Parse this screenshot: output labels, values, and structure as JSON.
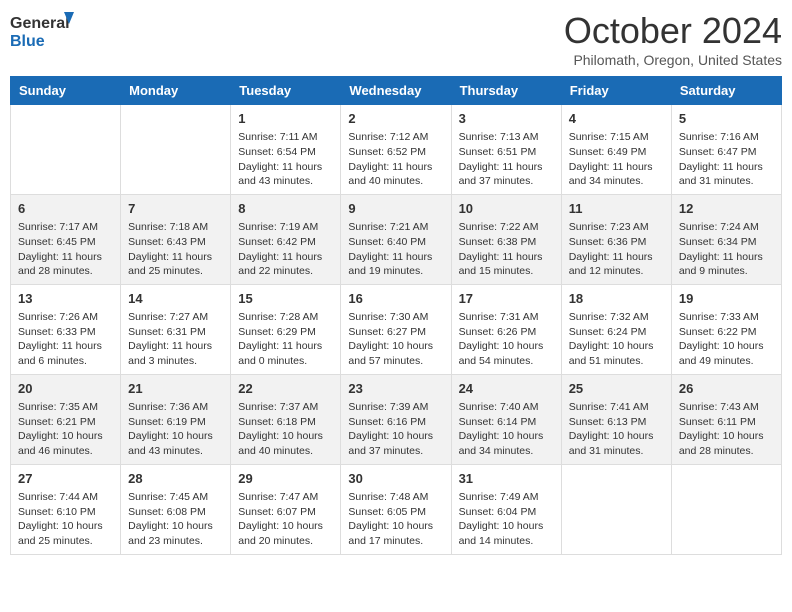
{
  "header": {
    "logo_line1": "General",
    "logo_line2": "Blue",
    "month": "October 2024",
    "location": "Philomath, Oregon, United States"
  },
  "days_of_week": [
    "Sunday",
    "Monday",
    "Tuesday",
    "Wednesday",
    "Thursday",
    "Friday",
    "Saturday"
  ],
  "weeks": [
    [
      {
        "day": "",
        "sunrise": "",
        "sunset": "",
        "daylight": ""
      },
      {
        "day": "",
        "sunrise": "",
        "sunset": "",
        "daylight": ""
      },
      {
        "day": "1",
        "sunrise": "Sunrise: 7:11 AM",
        "sunset": "Sunset: 6:54 PM",
        "daylight": "Daylight: 11 hours and 43 minutes."
      },
      {
        "day": "2",
        "sunrise": "Sunrise: 7:12 AM",
        "sunset": "Sunset: 6:52 PM",
        "daylight": "Daylight: 11 hours and 40 minutes."
      },
      {
        "day": "3",
        "sunrise": "Sunrise: 7:13 AM",
        "sunset": "Sunset: 6:51 PM",
        "daylight": "Daylight: 11 hours and 37 minutes."
      },
      {
        "day": "4",
        "sunrise": "Sunrise: 7:15 AM",
        "sunset": "Sunset: 6:49 PM",
        "daylight": "Daylight: 11 hours and 34 minutes."
      },
      {
        "day": "5",
        "sunrise": "Sunrise: 7:16 AM",
        "sunset": "Sunset: 6:47 PM",
        "daylight": "Daylight: 11 hours and 31 minutes."
      }
    ],
    [
      {
        "day": "6",
        "sunrise": "Sunrise: 7:17 AM",
        "sunset": "Sunset: 6:45 PM",
        "daylight": "Daylight: 11 hours and 28 minutes."
      },
      {
        "day": "7",
        "sunrise": "Sunrise: 7:18 AM",
        "sunset": "Sunset: 6:43 PM",
        "daylight": "Daylight: 11 hours and 25 minutes."
      },
      {
        "day": "8",
        "sunrise": "Sunrise: 7:19 AM",
        "sunset": "Sunset: 6:42 PM",
        "daylight": "Daylight: 11 hours and 22 minutes."
      },
      {
        "day": "9",
        "sunrise": "Sunrise: 7:21 AM",
        "sunset": "Sunset: 6:40 PM",
        "daylight": "Daylight: 11 hours and 19 minutes."
      },
      {
        "day": "10",
        "sunrise": "Sunrise: 7:22 AM",
        "sunset": "Sunset: 6:38 PM",
        "daylight": "Daylight: 11 hours and 15 minutes."
      },
      {
        "day": "11",
        "sunrise": "Sunrise: 7:23 AM",
        "sunset": "Sunset: 6:36 PM",
        "daylight": "Daylight: 11 hours and 12 minutes."
      },
      {
        "day": "12",
        "sunrise": "Sunrise: 7:24 AM",
        "sunset": "Sunset: 6:34 PM",
        "daylight": "Daylight: 11 hours and 9 minutes."
      }
    ],
    [
      {
        "day": "13",
        "sunrise": "Sunrise: 7:26 AM",
        "sunset": "Sunset: 6:33 PM",
        "daylight": "Daylight: 11 hours and 6 minutes."
      },
      {
        "day": "14",
        "sunrise": "Sunrise: 7:27 AM",
        "sunset": "Sunset: 6:31 PM",
        "daylight": "Daylight: 11 hours and 3 minutes."
      },
      {
        "day": "15",
        "sunrise": "Sunrise: 7:28 AM",
        "sunset": "Sunset: 6:29 PM",
        "daylight": "Daylight: 11 hours and 0 minutes."
      },
      {
        "day": "16",
        "sunrise": "Sunrise: 7:30 AM",
        "sunset": "Sunset: 6:27 PM",
        "daylight": "Daylight: 10 hours and 57 minutes."
      },
      {
        "day": "17",
        "sunrise": "Sunrise: 7:31 AM",
        "sunset": "Sunset: 6:26 PM",
        "daylight": "Daylight: 10 hours and 54 minutes."
      },
      {
        "day": "18",
        "sunrise": "Sunrise: 7:32 AM",
        "sunset": "Sunset: 6:24 PM",
        "daylight": "Daylight: 10 hours and 51 minutes."
      },
      {
        "day": "19",
        "sunrise": "Sunrise: 7:33 AM",
        "sunset": "Sunset: 6:22 PM",
        "daylight": "Daylight: 10 hours and 49 minutes."
      }
    ],
    [
      {
        "day": "20",
        "sunrise": "Sunrise: 7:35 AM",
        "sunset": "Sunset: 6:21 PM",
        "daylight": "Daylight: 10 hours and 46 minutes."
      },
      {
        "day": "21",
        "sunrise": "Sunrise: 7:36 AM",
        "sunset": "Sunset: 6:19 PM",
        "daylight": "Daylight: 10 hours and 43 minutes."
      },
      {
        "day": "22",
        "sunrise": "Sunrise: 7:37 AM",
        "sunset": "Sunset: 6:18 PM",
        "daylight": "Daylight: 10 hours and 40 minutes."
      },
      {
        "day": "23",
        "sunrise": "Sunrise: 7:39 AM",
        "sunset": "Sunset: 6:16 PM",
        "daylight": "Daylight: 10 hours and 37 minutes."
      },
      {
        "day": "24",
        "sunrise": "Sunrise: 7:40 AM",
        "sunset": "Sunset: 6:14 PM",
        "daylight": "Daylight: 10 hours and 34 minutes."
      },
      {
        "day": "25",
        "sunrise": "Sunrise: 7:41 AM",
        "sunset": "Sunset: 6:13 PM",
        "daylight": "Daylight: 10 hours and 31 minutes."
      },
      {
        "day": "26",
        "sunrise": "Sunrise: 7:43 AM",
        "sunset": "Sunset: 6:11 PM",
        "daylight": "Daylight: 10 hours and 28 minutes."
      }
    ],
    [
      {
        "day": "27",
        "sunrise": "Sunrise: 7:44 AM",
        "sunset": "Sunset: 6:10 PM",
        "daylight": "Daylight: 10 hours and 25 minutes."
      },
      {
        "day": "28",
        "sunrise": "Sunrise: 7:45 AM",
        "sunset": "Sunset: 6:08 PM",
        "daylight": "Daylight: 10 hours and 23 minutes."
      },
      {
        "day": "29",
        "sunrise": "Sunrise: 7:47 AM",
        "sunset": "Sunset: 6:07 PM",
        "daylight": "Daylight: 10 hours and 20 minutes."
      },
      {
        "day": "30",
        "sunrise": "Sunrise: 7:48 AM",
        "sunset": "Sunset: 6:05 PM",
        "daylight": "Daylight: 10 hours and 17 minutes."
      },
      {
        "day": "31",
        "sunrise": "Sunrise: 7:49 AM",
        "sunset": "Sunset: 6:04 PM",
        "daylight": "Daylight: 10 hours and 14 minutes."
      },
      {
        "day": "",
        "sunrise": "",
        "sunset": "",
        "daylight": ""
      },
      {
        "day": "",
        "sunrise": "",
        "sunset": "",
        "daylight": ""
      }
    ]
  ]
}
